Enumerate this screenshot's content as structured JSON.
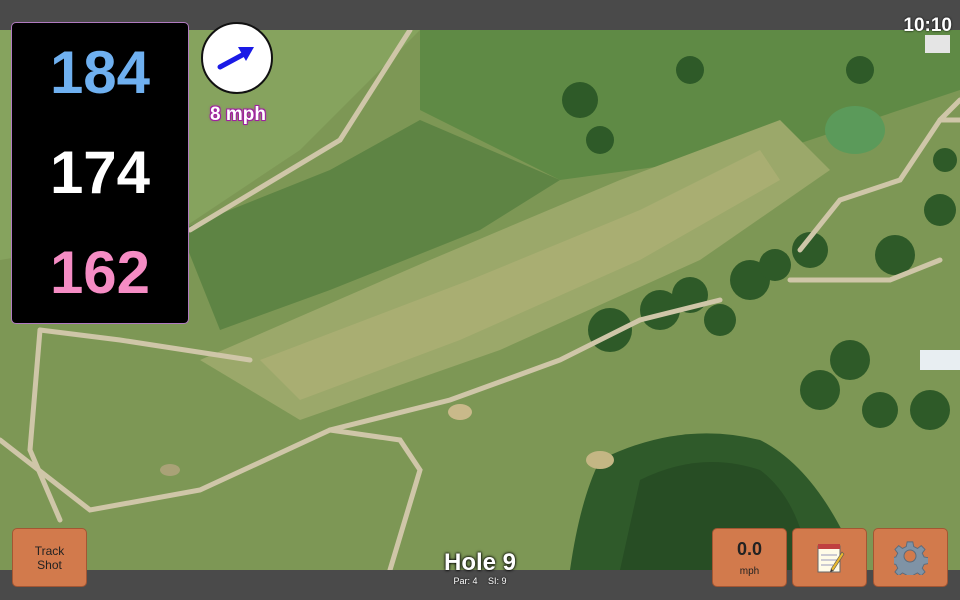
{
  "status": {
    "time": "10:10"
  },
  "distances": {
    "back": {
      "value": "184",
      "color": "#6fb0f0"
    },
    "middle": {
      "value": "174",
      "color": "#ffffff"
    },
    "front": {
      "value": "162",
      "color": "#f58cc4"
    }
  },
  "wind": {
    "speed_label": "8 mph",
    "arrow_color": "#1a1ae6",
    "icon": "wind-arrow-icon"
  },
  "buttons": {
    "track_shot": {
      "line1": "Track",
      "line2": "Shot"
    },
    "speed": {
      "value": "0.0",
      "unit": "mph"
    },
    "notes": {
      "icon": "notepad-icon"
    },
    "settings": {
      "icon": "gear-icon"
    }
  },
  "hole": {
    "title": "Hole 9",
    "par_label": "Par: 4",
    "si_label": "SI: 9"
  },
  "colors": {
    "button_bg": "#d27a4c",
    "bar_bg": "#4a4a4a",
    "panel_border": "#b07ac0"
  }
}
